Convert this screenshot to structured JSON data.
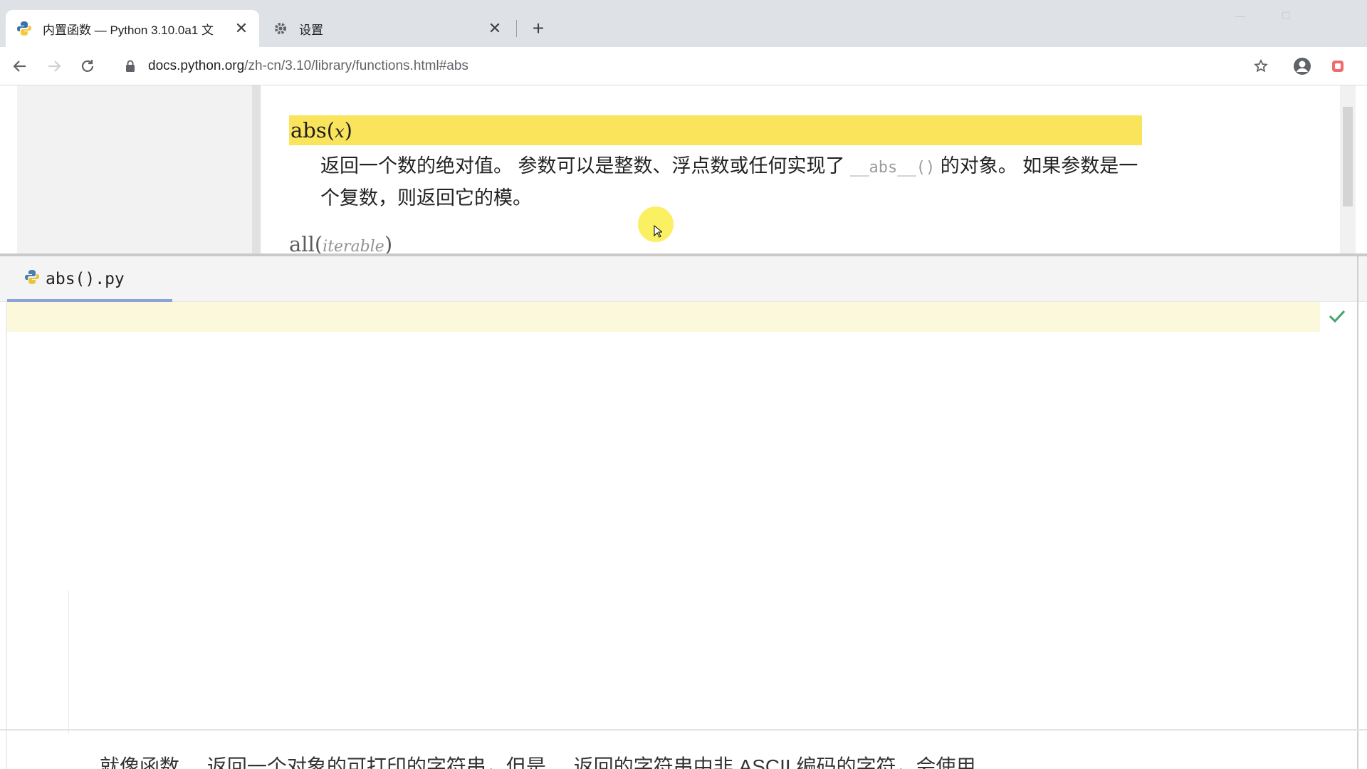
{
  "browser": {
    "tabs": [
      {
        "title": "内置函数 — Python 3.10.0a1 文",
        "active": true,
        "icon": "python-icon"
      },
      {
        "title": "设置",
        "active": false,
        "icon": "gear-icon"
      }
    ],
    "close_glyph": "✕",
    "new_tab_glyph": "+",
    "url_host": "docs.python.org",
    "url_path": "/zh-cn/3.10/library/functions.html#abs"
  },
  "doc": {
    "signature_name": "abs(",
    "signature_arg": "x",
    "signature_close": ")",
    "description_1": "返回一个数的绝对值。 参数可以是整数、浮点数或任何实现了 ",
    "description_code": "__abs__()",
    "description_2": " 的对象。 如果参数是一个复数，则返回它的模。",
    "next_signature_name": "all(",
    "next_signature_arg": "iterable",
    "next_signature_close": ")",
    "highlight_color": "#f9e45b"
  },
  "editor": {
    "file_tab": "abs().py",
    "status_icon": "check-icon",
    "caption_partial": "就像函数 ... 返回一个对象的可打印的字符串，但是 ... 返回的字符串中非 ASCII 编码的字符，会使用"
  }
}
